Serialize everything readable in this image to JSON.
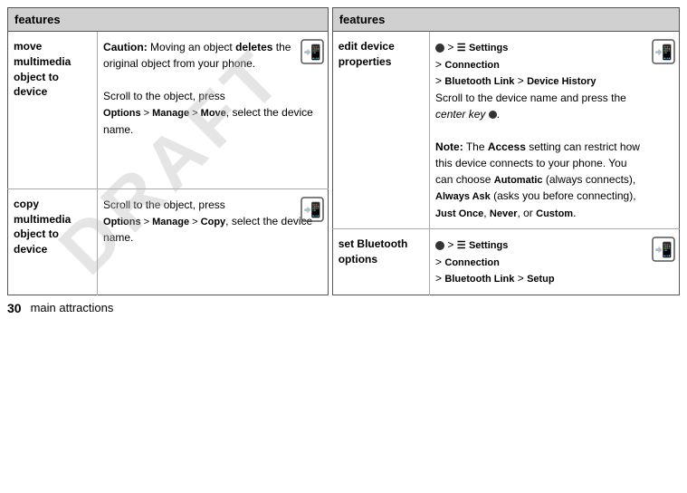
{
  "page": {
    "draft_watermark": "DRAFT",
    "footer_number": "30",
    "footer_text": "main attractions"
  },
  "left_table": {
    "header": "features",
    "rows": [
      {
        "feature": "move multimedia object to device",
        "description_parts": [
          {
            "type": "caution_intro",
            "text": "Caution: Moving an object "
          },
          {
            "type": "bold",
            "text": "deletes"
          },
          {
            "type": "text",
            "text": " the original object from your phone."
          },
          {
            "type": "break"
          },
          {
            "type": "text",
            "text": "Scroll to the object, press "
          },
          {
            "type": "break"
          },
          {
            "type": "menu",
            "text": "Options > Manage > Move"
          },
          {
            "type": "text",
            "text": ", select the device name."
          }
        ],
        "has_icon": true
      },
      {
        "feature": "copy multimedia object to device",
        "description_parts": [
          {
            "type": "text",
            "text": "Scroll to the object, press "
          },
          {
            "type": "break"
          },
          {
            "type": "menu",
            "text": "Options > Manage > Copy"
          },
          {
            "type": "text",
            "text": ", select the device name."
          }
        ],
        "has_icon": true
      }
    ]
  },
  "right_table": {
    "header": "features",
    "rows": [
      {
        "feature": "edit device properties",
        "description_parts": [
          {
            "type": "nav_line",
            "text": "s > Settings > Connection > Bluetooth Link > Device History"
          },
          {
            "type": "break"
          },
          {
            "type": "text",
            "text": "Scroll to the device name and press the "
          },
          {
            "type": "italic",
            "text": "center key"
          },
          {
            "type": "bullet_dot"
          },
          {
            "type": "text",
            "text": "."
          },
          {
            "type": "break2"
          },
          {
            "type": "bold",
            "text": "Note:"
          },
          {
            "type": "text",
            "text": " The "
          },
          {
            "type": "bold",
            "text": "Access"
          },
          {
            "type": "text",
            "text": " setting can restrict how this device connects to your phone. You can choose "
          },
          {
            "type": "mono_bold",
            "text": "Automatic"
          },
          {
            "type": "text",
            "text": " (always connects), "
          },
          {
            "type": "mono_bold",
            "text": "Always Ask"
          },
          {
            "type": "text",
            "text": " (asks you before connecting), "
          },
          {
            "type": "mono_bold",
            "text": "Just Once"
          },
          {
            "type": "text",
            "text": ", "
          },
          {
            "type": "mono_bold",
            "text": "Never"
          },
          {
            "type": "text",
            "text": ", or "
          },
          {
            "type": "mono_bold",
            "text": "Custom"
          },
          {
            "type": "text",
            "text": "."
          }
        ],
        "has_icon": true
      },
      {
        "feature": "set Bluetooth options",
        "description_parts": [
          {
            "type": "nav_line",
            "text": "s > Settings > Connection > Bluetooth Link > Setup"
          }
        ],
        "has_icon": true
      }
    ]
  }
}
